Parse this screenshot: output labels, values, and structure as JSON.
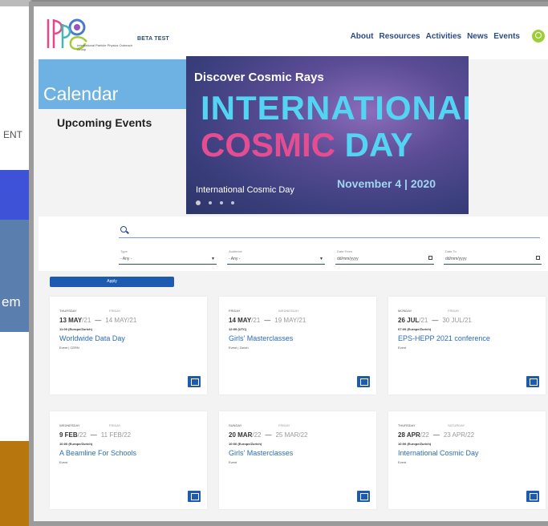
{
  "background_window": {
    "frag_events": "ENT",
    "frag_em": "em"
  },
  "header": {
    "beta": "BETA TEST",
    "logo_letters": "IPPOG",
    "logo_sub": "International Particle Physics Outreach Group",
    "nav": [
      "About",
      "Resources",
      "Activities",
      "News",
      "Events"
    ]
  },
  "calendar": {
    "title": "Calendar",
    "upcoming": "Upcoming Events"
  },
  "banner": {
    "line1": "Discover Cosmic Rays",
    "line2": "INTERNATIONAL",
    "line3a": "COSMIC",
    "line3b": "DAY",
    "date": "November 4 | 2020",
    "caption": "International Cosmic Day"
  },
  "filters": {
    "type_label": "Type",
    "type_value": "- Any -",
    "audience_label": "Audience",
    "audience_value": "- Any -",
    "from_label": "Date From",
    "from_placeholder": "dd/mm/yyyy",
    "to_label": "Date To",
    "to_placeholder": "dd/mm/yyyy",
    "apply": "Apply"
  },
  "events": [
    {
      "day1": "THURSDAY",
      "day2": "FRIDAY",
      "start": "13 MAY",
      "start_yr": "/21",
      "end": "14 MAY",
      "end_yr": "/21",
      "time": "11:00 (Europe/Zurich)",
      "title": "Worldwide Data Day",
      "meta": "Event | CERN"
    },
    {
      "day1": "FRIDAY",
      "day2": "WEDNESDAY",
      "start": "14 MAY",
      "start_yr": "/21",
      "end": "19 MAY",
      "end_yr": "/21",
      "time": "12:09 (UTC)",
      "title": "Girls' Masterclasses",
      "meta": "Event | Zurich"
    },
    {
      "day1": "MONDAY",
      "day2": "FRIDAY",
      "start": "26 JUL",
      "start_yr": "/21",
      "end": "30 JUL",
      "end_yr": "/21",
      "time": "07:00 (Europe/Zurich)",
      "title": "EPS-HEPP 2021 conference",
      "meta": "Event"
    },
    {
      "day1": "WEDNESDAY",
      "day2": "FRIDAY",
      "start": "9 FEB",
      "start_yr": "/22",
      "end": "11 FEB",
      "end_yr": "/22",
      "time": "10:00 (Europe/Zurich)",
      "title": "A Beamline For Schools",
      "meta": "Event"
    },
    {
      "day1": "SUNDAY",
      "day2": "FRIDAY",
      "start": "20 MAR",
      "start_yr": "/22",
      "end": "25 MAR",
      "end_yr": "/22",
      "time": "10:00 (Europe/Zurich)",
      "title": "Girls' Masterclasses",
      "meta": "Event"
    },
    {
      "day1": "THURSDAY",
      "day2": "SATURDAY",
      "start": "28 APR",
      "start_yr": "/22",
      "end": "23 APR",
      "end_yr": "/22",
      "time": "10:00 (Europe/Zurich)",
      "title": "International Cosmic Day",
      "meta": "Event"
    }
  ],
  "colors": {
    "nav_blue": "#2b4a86",
    "calendar_blue": "#6eb1e3",
    "button_blue": "#1e5ab0",
    "search_green": "#9ecd38"
  }
}
